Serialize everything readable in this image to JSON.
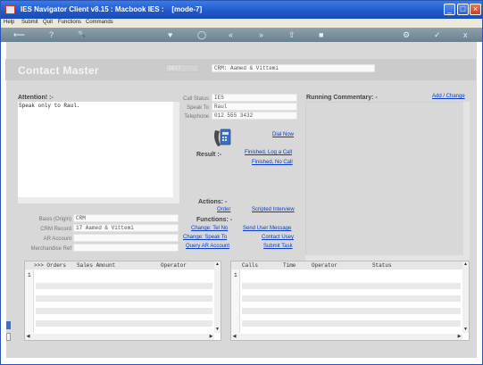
{
  "window": {
    "title": "IES Navigator Client v8.15 : Macbook IES :    [mode-7]",
    "controls": {
      "minimize": "_",
      "maximize": "□",
      "close": "×"
    }
  },
  "menubar": {
    "items": [
      "Help",
      "Submit",
      "Quit",
      "Functions",
      "Commands"
    ]
  },
  "toolbar": {
    "glyphs": [
      "⟵",
      "?",
      "🔍",
      "♥",
      "◯",
      "«",
      "»",
      "⇧",
      "■",
      "⚙",
      "✓",
      "x"
    ]
  },
  "form": {
    "title": "Contact Master",
    "id_field": "3017",
    "crm_header": "CRM: Aamed & Vittemi"
  },
  "attention": {
    "label": "Attention! :-",
    "text": "Speak only to Raul."
  },
  "call_fields": {
    "call_status_label": "Call Status",
    "call_status_value": "IES",
    "speak_to_label": "Speak To",
    "speak_to_value": "Raul",
    "telephone_label": "Telephone",
    "telephone_value": "012 555 3432"
  },
  "commentary": {
    "label": "Running Commentary: -",
    "add_change": "Add / Change"
  },
  "dial": {
    "dial_now": "Dial Now",
    "result_label": "Result :-",
    "finished_log": "Finished, Log a Call",
    "finished_no": "Finished, No Call"
  },
  "actions": {
    "label": "Actions: -",
    "order": "Order",
    "scripted": "Scripted Interview"
  },
  "functions": {
    "label": "Functions: -",
    "change_tel": "Change: Tel No",
    "change_speak": "Change: Speak To",
    "query_ar": "Query AR Account",
    "send_user_msg": "Send User Message",
    "contact_user": "Contact Usey",
    "submit_task": "Submit Task"
  },
  "left_fields": {
    "basis_label": "Basis (Origin)",
    "basis_value": "CRM",
    "crm_record_label": "CRM Record",
    "crm_record_value": "17 Aamed & Vittemi",
    "ar_account_label": "AR Account",
    "ar_account_value": "",
    "merchandise_label": "Merchandise Ref",
    "merchandise_value": ""
  },
  "orders_grid": {
    "columns": [
      ">>> Orders",
      "Sales Amount",
      "Operator"
    ],
    "row_number": "1"
  },
  "calls_grid": {
    "columns": [
      "Calls",
      "Time",
      "Operator",
      "Status"
    ],
    "row_number": "1"
  }
}
